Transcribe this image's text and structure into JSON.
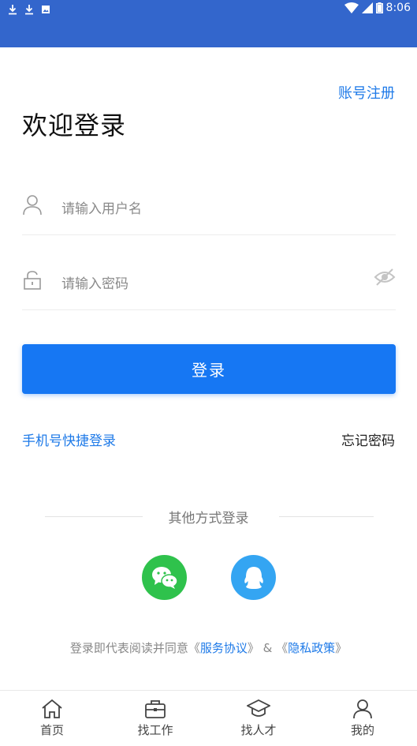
{
  "status_bar": {
    "time": "8:06",
    "icons": [
      "download-icon",
      "download-icon",
      "image-icon",
      "wifi-icon",
      "signal-icon",
      "battery-icon"
    ]
  },
  "header": {
    "register_link": "账号注册",
    "title": "欢迎登录"
  },
  "form": {
    "username_placeholder": "请输入用户名",
    "password_placeholder": "请输入密码",
    "login_button": "登录"
  },
  "links": {
    "quick_login": "手机号快捷登录",
    "forgot_password": "忘记密码"
  },
  "other_login": {
    "label": "其他方式登录",
    "providers": [
      "wechat-icon",
      "qq-icon"
    ]
  },
  "agreement": {
    "prefix": "登录即代表阅读并同意",
    "open1": "《",
    "service": "服务协议",
    "close1": "》",
    "amp": " & ",
    "open2": "《",
    "privacy": "隐私政策",
    "close2": "》"
  },
  "tabs": [
    {
      "label": "首页",
      "icon": "home-icon"
    },
    {
      "label": "找工作",
      "icon": "briefcase-icon"
    },
    {
      "label": "找人才",
      "icon": "graduation-cap-icon"
    },
    {
      "label": "我的",
      "icon": "user-icon"
    }
  ],
  "colors": {
    "status_bar": "#3366cc",
    "primary": "#1677f3",
    "link": "#1e7ae8",
    "wechat": "#2fc24c",
    "qq": "#34a5f2"
  }
}
